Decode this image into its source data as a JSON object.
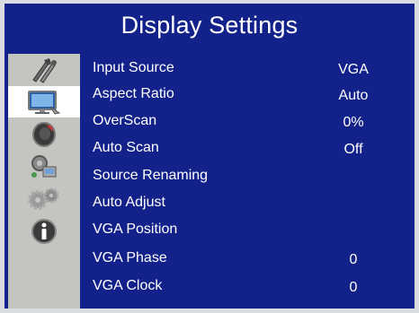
{
  "title": "Display Settings",
  "sidebar": {
    "items": [
      {
        "icon": "tools-icon",
        "active": false
      },
      {
        "icon": "display-monitor-icon",
        "active": true
      },
      {
        "icon": "speaker-icon",
        "active": false
      },
      {
        "icon": "network-settings-icon",
        "active": false
      },
      {
        "icon": "gears-icon",
        "active": false
      },
      {
        "icon": "info-icon",
        "active": false
      }
    ]
  },
  "menu": {
    "rows": [
      {
        "label": "Input Source",
        "value": "VGA"
      },
      {
        "label": "Aspect Ratio",
        "value": "Auto"
      },
      {
        "label": "OverScan",
        "value": "0%"
      },
      {
        "label": "Auto Scan",
        "value": "Off"
      },
      {
        "label": "Source Renaming",
        "value": ""
      },
      {
        "label": "Auto Adjust",
        "value": ""
      },
      {
        "label": "VGA Position",
        "value": ""
      },
      {
        "label": "VGA Phase",
        "value": "0"
      },
      {
        "label": "VGA Clock",
        "value": "0"
      }
    ]
  },
  "colors": {
    "background": "#13228a",
    "sidebar": "#c4c4c0",
    "sidebar_active": "#ffffff",
    "text": "#ffffff"
  }
}
